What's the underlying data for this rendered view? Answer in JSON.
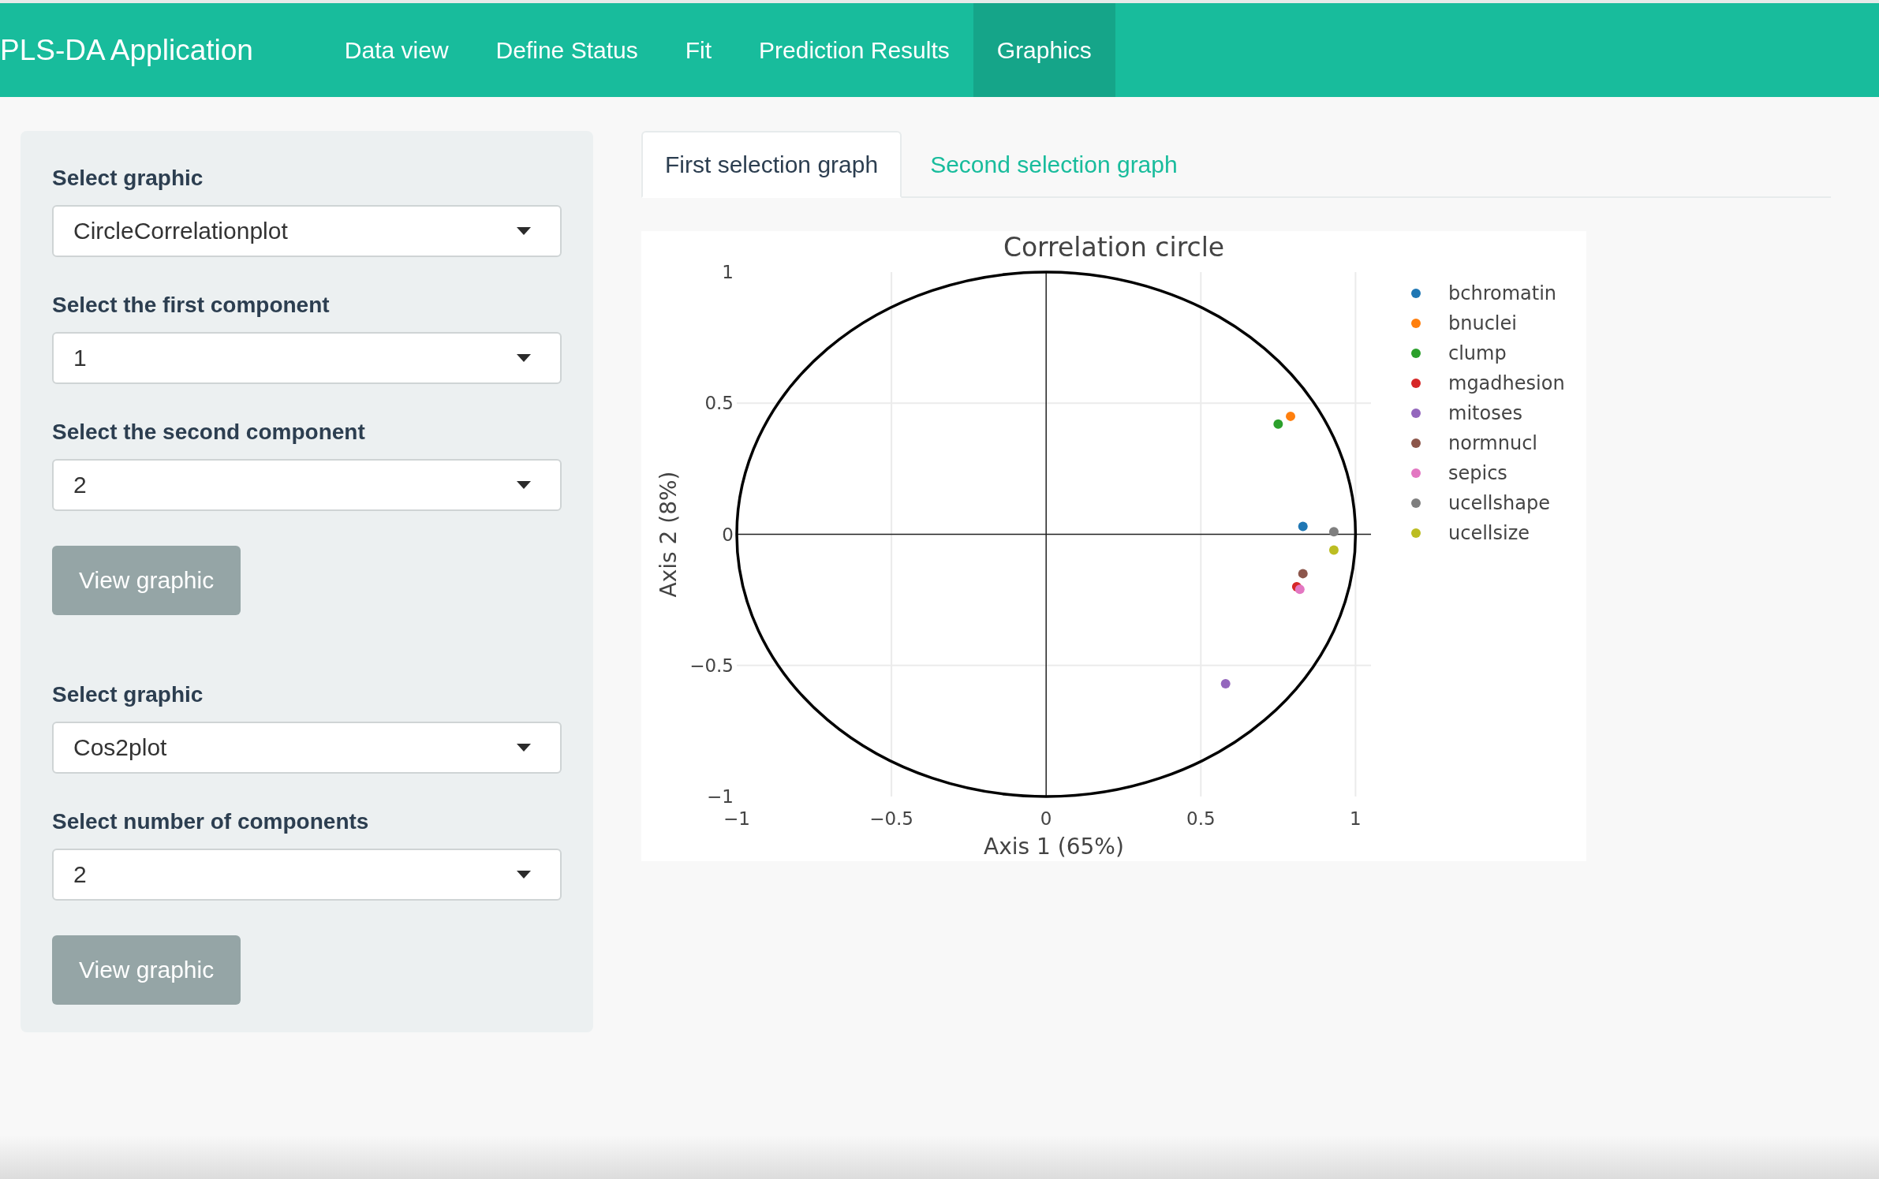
{
  "navbar": {
    "brand": "PLS-DA Application",
    "items": [
      {
        "label": "Data view",
        "selected": false
      },
      {
        "label": "Define Status",
        "selected": false
      },
      {
        "label": "Fit",
        "selected": false
      },
      {
        "label": "Prediction Results",
        "selected": false
      },
      {
        "label": "Graphics",
        "selected": true
      }
    ]
  },
  "sidebar": {
    "groups": [
      {
        "fields": [
          {
            "label": "Select graphic",
            "value": "CircleCorrelationplot"
          },
          {
            "label": "Select the first component",
            "value": "1"
          },
          {
            "label": "Select the second component",
            "value": "2"
          }
        ],
        "button": "View graphic"
      },
      {
        "fields": [
          {
            "label": "Select graphic",
            "value": "Cos2plot"
          },
          {
            "label": "Select number of components",
            "value": "2"
          }
        ],
        "button": "View graphic"
      }
    ]
  },
  "main": {
    "tabs": [
      {
        "label": "First selection graph",
        "selected": true
      },
      {
        "label": "Second selection graph",
        "selected": false
      }
    ],
    "plot": {
      "chart_data": {
        "type": "scatter",
        "title": "Correlation circle",
        "xlabel": "Axis 1 (65%)",
        "ylabel": "Axis 2 (8%)",
        "series": [
          {
            "name": "bchromatin",
            "color": "#1f77b4",
            "x": [
              0.83
            ],
            "values": [
              0.03
            ]
          },
          {
            "name": "bnuclei",
            "color": "#ff7f0e",
            "x": [
              0.79
            ],
            "values": [
              0.45
            ]
          },
          {
            "name": "clump",
            "color": "#2ca02c",
            "x": [
              0.75
            ],
            "values": [
              0.42
            ]
          },
          {
            "name": "mgadhesion",
            "color": "#d62728",
            "x": [
              0.81
            ],
            "values": [
              -0.2
            ]
          },
          {
            "name": "mitoses",
            "color": "#9467bd",
            "x": [
              0.58
            ],
            "values": [
              -0.57
            ]
          },
          {
            "name": "normnucl",
            "color": "#8c564b",
            "x": [
              0.83
            ],
            "values": [
              -0.15
            ]
          },
          {
            "name": "sepics",
            "color": "#e377c2",
            "x": [
              0.82
            ],
            "values": [
              -0.21
            ]
          },
          {
            "name": "ucellshape",
            "color": "#7f7f7f",
            "x": [
              0.93
            ],
            "values": [
              0.01
            ]
          },
          {
            "name": "ucellsize",
            "color": "#bcbd22",
            "x": [
              0.93
            ],
            "values": [
              -0.06
            ]
          }
        ],
        "xlim": [
          -1,
          1.05
        ],
        "ylim": [
          -1,
          1
        ],
        "xticks": [
          {
            "value": -1,
            "label": "−1"
          },
          {
            "value": -0.5,
            "label": "−0.5"
          },
          {
            "value": 0,
            "label": "0"
          },
          {
            "value": 0.5,
            "label": "0.5"
          },
          {
            "value": 1,
            "label": "1"
          }
        ],
        "yticks": [
          {
            "value": -1,
            "label": "−1"
          },
          {
            "value": -0.5,
            "label": "−0.5"
          },
          {
            "value": 0,
            "label": "0"
          },
          {
            "value": 0.5,
            "label": "0.5"
          },
          {
            "value": 1,
            "label": "1"
          }
        ],
        "grid": true,
        "legend": true
      }
    }
  }
}
